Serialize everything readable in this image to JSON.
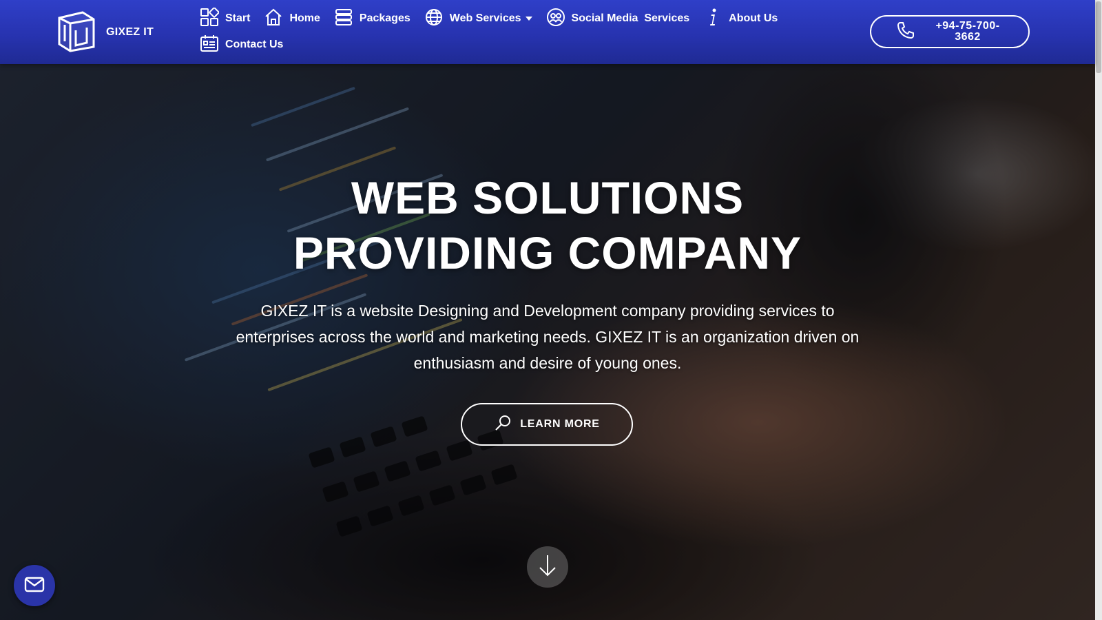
{
  "brand": {
    "name": "GIXEZ IT",
    "logo_icon": "cube-logo-icon"
  },
  "nav": {
    "items": [
      {
        "label": "Start",
        "icon": "grid-icon"
      },
      {
        "label": "Home",
        "icon": "home-icon"
      },
      {
        "label": "Packages",
        "icon": "layers-icon"
      },
      {
        "label": "Web Services",
        "icon": "globe-icon",
        "has_dropdown": true
      },
      {
        "label": "Social Media  Services",
        "icon": "social-heads-icon"
      },
      {
        "label": "About Us",
        "icon": "info-icon"
      },
      {
        "label": "Contact Us",
        "icon": "contact-card-icon"
      }
    ]
  },
  "header": {
    "phone": {
      "line1": "+94-75-700-",
      "line2": "3662",
      "icon": "phone-icon"
    }
  },
  "hero": {
    "title_line1": "WEB SOLUTIONS",
    "title_line2": "PROVIDING COMPANY",
    "description": "GIXEZ IT is a website Designing and Development company providing services to enterprises across the world and marketing needs. GIXEZ IT is an organization driven on enthusiasm and desire of young ones.",
    "cta_label": "LEARN MORE",
    "cta_icon": "search-icon",
    "scroll_icon": "arrow-down-icon"
  },
  "floating": {
    "mail_icon": "mail-icon"
  },
  "colors": {
    "header": "#2b37b8",
    "fab": "#2a34a8",
    "text": "#ffffff"
  }
}
